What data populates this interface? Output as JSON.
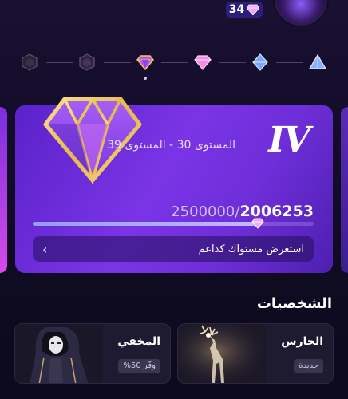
{
  "header": {
    "gems_count": "34",
    "gem_color": "#f0aaf5"
  },
  "level_track": {
    "nodes": [
      "locked-gem-icon",
      "locked-gem-icon",
      "pink-gem-icon",
      "pink-gem-icon",
      "blue-gem-icon",
      "blue-triangle-icon"
    ],
    "active_index": 2
  },
  "level_card": {
    "tier": "IV",
    "range": "المستوى 30 - المستوى 39",
    "progress_current": "2006253",
    "progress_total": "2500000/",
    "progress_fraction": 0.8025,
    "view_all_label": "استعرض مستواك كداعم",
    "accent": "#7a34e6"
  },
  "characters": {
    "title": "الشخصيات",
    "items": [
      {
        "name": "الحارس",
        "tag": "جديدة"
      },
      {
        "name": "المخفي",
        "tag": "وفّر 50%"
      }
    ]
  }
}
